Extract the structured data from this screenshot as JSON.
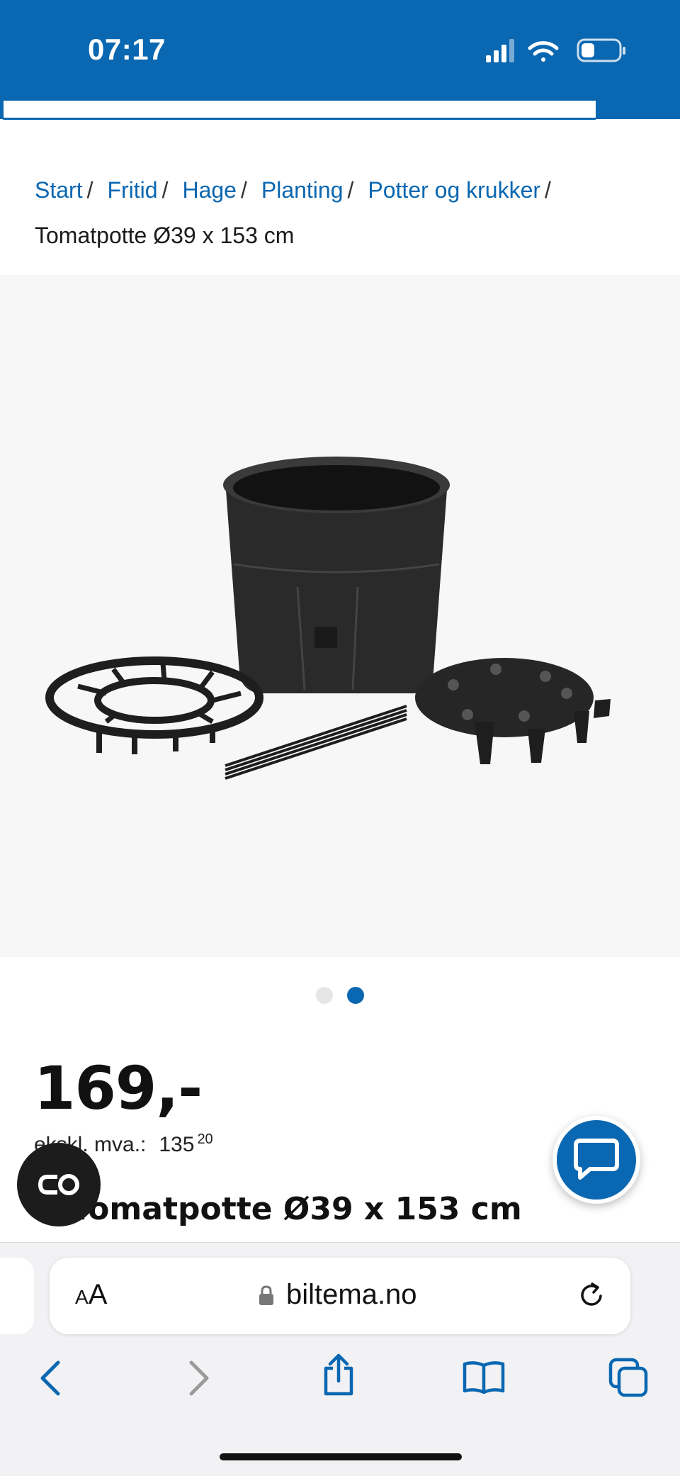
{
  "status_bar": {
    "time": "07:17"
  },
  "breadcrumb": {
    "items": [
      "Start",
      "Fritid",
      "Hage",
      "Planting",
      "Potter og krukker"
    ],
    "separator": "/",
    "current": "Tomatpotte Ø39 x 153 cm"
  },
  "carousel": {
    "count": 2,
    "active_index": 2
  },
  "product": {
    "price": "169,-",
    "vat_label": "ekskl. mva.:",
    "vat_value": "135",
    "vat_cents": "20",
    "title": "Tomatpotte Ø39 x 153 cm"
  },
  "browser": {
    "aa_label_small": "A",
    "aa_label_large": "A",
    "url": "biltema.no"
  },
  "icons": {
    "signal": "signal-icon",
    "wifi": "wifi-icon",
    "battery": "battery-icon",
    "chat": "chat-icon",
    "reader": "reader-icon",
    "lock": "lock-icon",
    "reload": "reload-icon",
    "back": "back-icon",
    "forward": "forward-icon",
    "share": "share-icon",
    "bookmarks": "bookmarks-icon",
    "tabs": "tabs-icon"
  },
  "colors": {
    "brand": "#0a67b1",
    "dot_inactive": "#e6e6e6",
    "image_bg": "#f7f7f7"
  }
}
